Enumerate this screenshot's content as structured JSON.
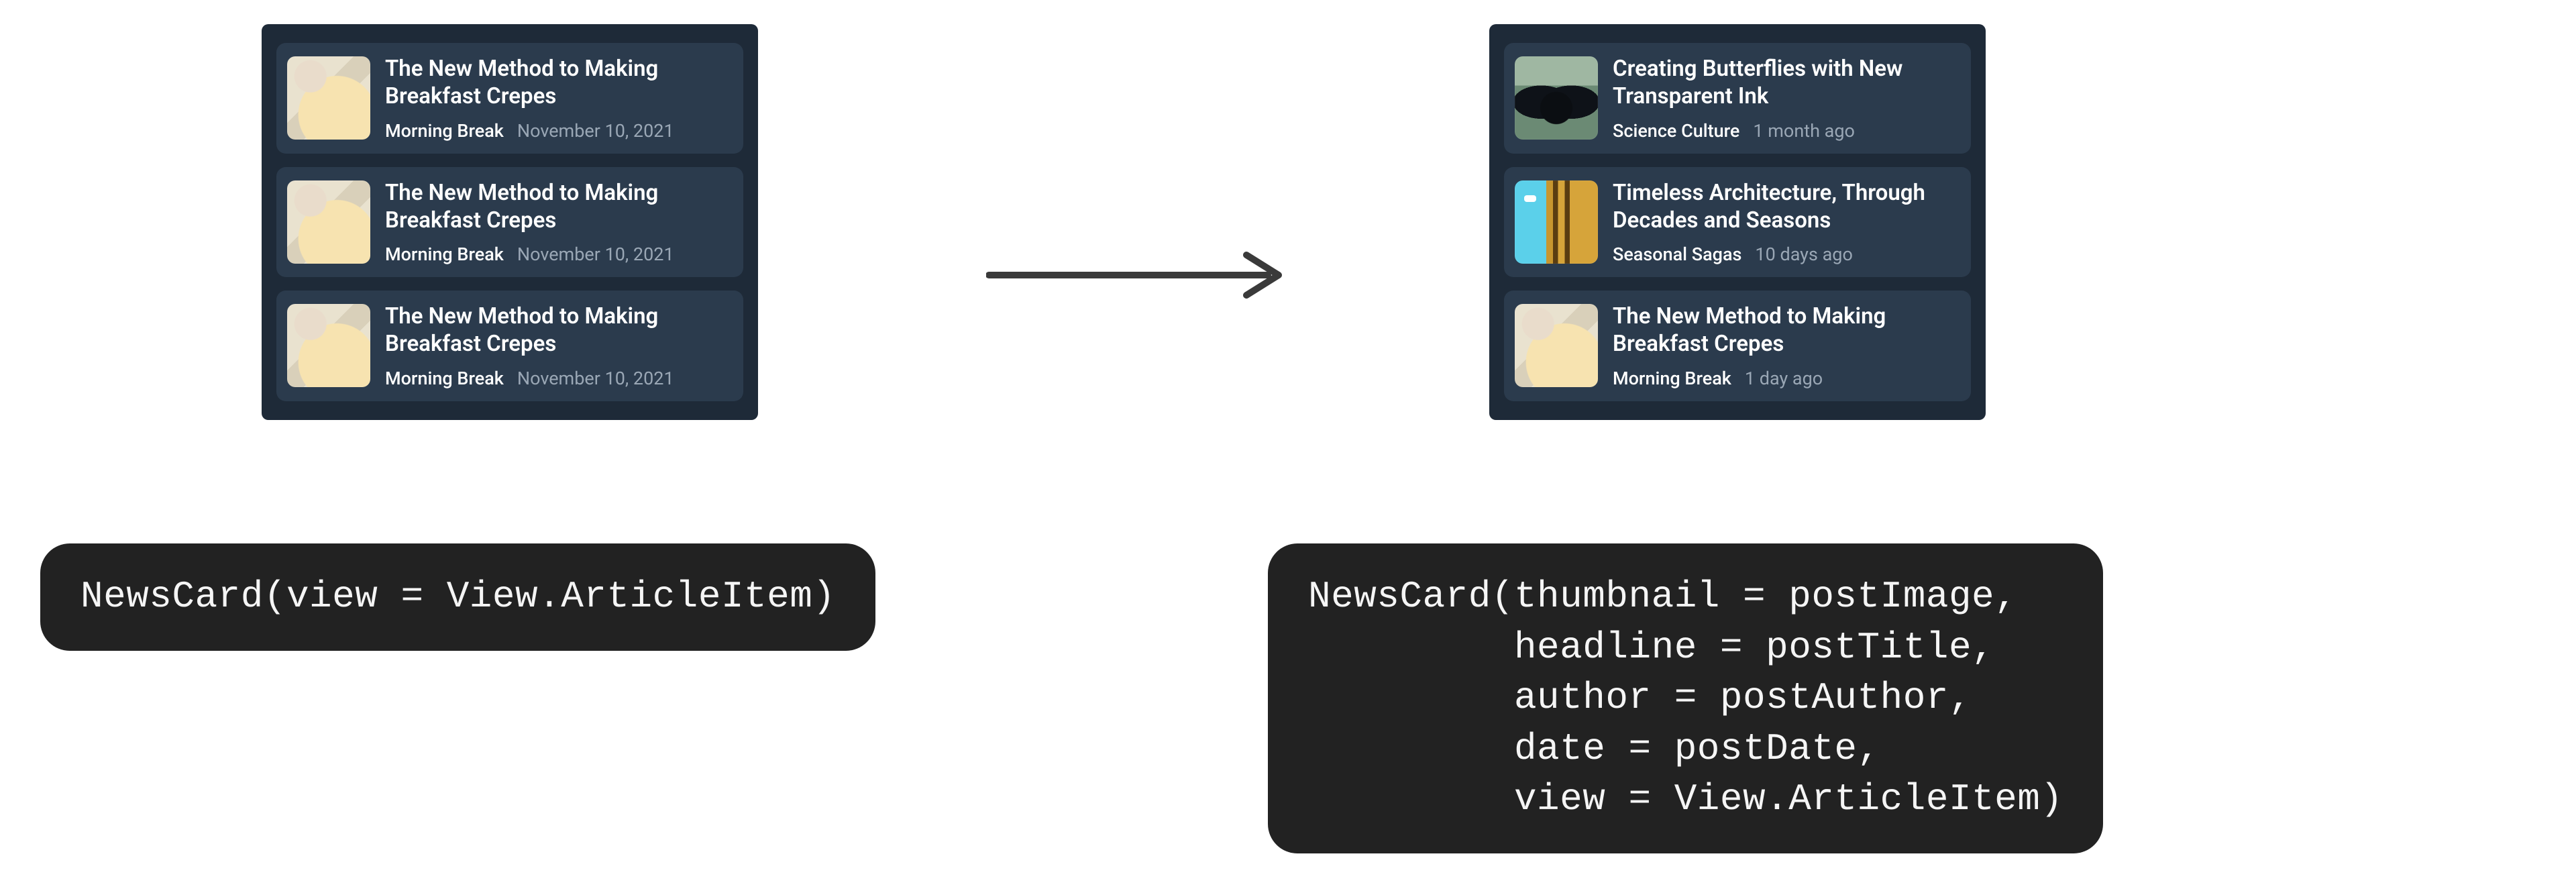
{
  "left_panel": {
    "cards": [
      {
        "thumbnail": "crepes",
        "headline": "The New Method to Making Breakfast Crepes",
        "author": "Morning Break",
        "date": "November 10, 2021"
      },
      {
        "thumbnail": "crepes",
        "headline": "The New Method to Making Breakfast Crepes",
        "author": "Morning Break",
        "date": "November 10, 2021"
      },
      {
        "thumbnail": "crepes",
        "headline": "The New Method to Making Breakfast Crepes",
        "author": "Morning Break",
        "date": "November 10, 2021"
      }
    ]
  },
  "right_panel": {
    "cards": [
      {
        "thumbnail": "butterfly",
        "headline": "Creating Butterflies with New Transparent Ink",
        "author": "Science Culture",
        "date": "1 month ago"
      },
      {
        "thumbnail": "arch",
        "headline": "Timeless Architecture, Through Decades and Seasons",
        "author": "Seasonal Sagas",
        "date": "10 days ago"
      },
      {
        "thumbnail": "crepes",
        "headline": "The New Method to Making Breakfast Crepes",
        "author": "Morning Break",
        "date": "1 day ago"
      }
    ]
  },
  "left_code": "NewsCard(view = View.ArticleItem)",
  "right_code": "NewsCard(thumbnail = postImage,\n         headline = postTitle,\n         author = postAuthor,\n         date = postDate,\n         view = View.ArticleItem)",
  "thumb_classes": {
    "crepes": "thumb-crepes",
    "butterfly": "thumb-butterfly",
    "arch": "thumb-arch"
  }
}
